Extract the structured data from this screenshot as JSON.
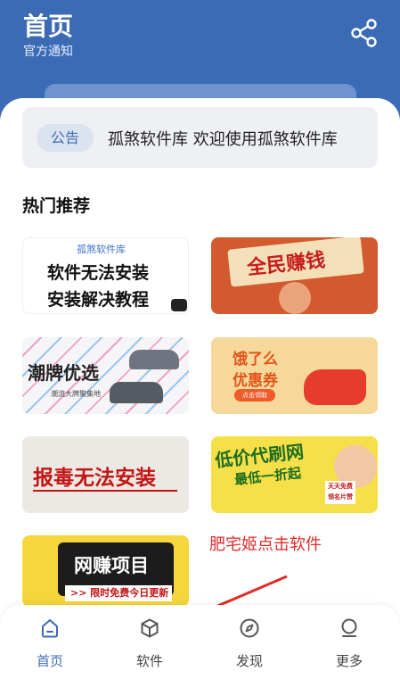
{
  "header": {
    "title": "首页",
    "subtitle": "官方通知",
    "share_icon": "share-icon"
  },
  "notice": {
    "badge": "公告",
    "text": "孤煞软件库  欢迎使用孤煞软件库"
  },
  "section": {
    "title": "热门推荐"
  },
  "cards": [
    {
      "brand": "孤煞软件库",
      "line1": "软件无法安装",
      "line2": "安装解决教程"
    },
    {
      "line1": "全民赚钱"
    },
    {
      "line1": "潮牌优选",
      "small": "潮流大牌聚集地"
    },
    {
      "line1": "饿了么",
      "line2": "优惠券",
      "button": "点击领取"
    },
    {
      "line1": "报毒无法安装"
    },
    {
      "line1": "低价代刷网",
      "line2": "最低一折起",
      "tag": "天天免费领名片赞"
    },
    {
      "line1": "网赚项目",
      "line2": ">> 限时免费今日更新"
    }
  ],
  "promo_link": "肥宅姬点击软件",
  "tabbar": {
    "items": [
      {
        "label": "首页",
        "icon": "home-icon",
        "active": true
      },
      {
        "label": "软件",
        "icon": "cube-icon",
        "active": false
      },
      {
        "label": "发现",
        "icon": "compass-icon",
        "active": false
      },
      {
        "label": "更多",
        "icon": "user-icon",
        "active": false
      }
    ]
  },
  "colors": {
    "primary": "#3c6bb5",
    "header_bg": "#3c6bb5",
    "promo_red": "#e22a2a"
  }
}
